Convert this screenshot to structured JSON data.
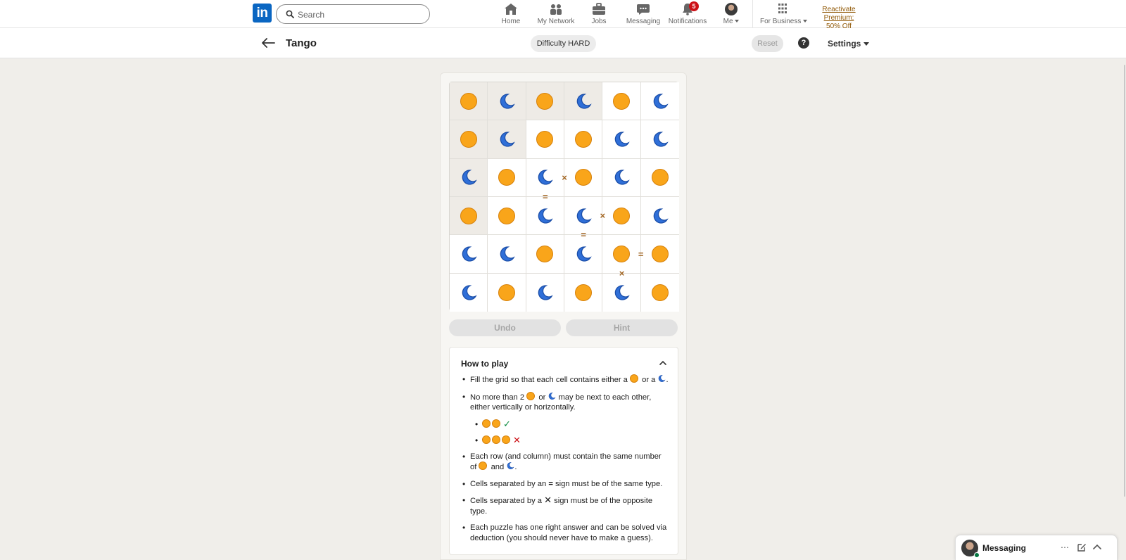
{
  "nav": {
    "logo": "in",
    "search_placeholder": "Search",
    "items": [
      {
        "label": "Home",
        "icon": "home-icon"
      },
      {
        "label": "My Network",
        "icon": "network-icon"
      },
      {
        "label": "Jobs",
        "icon": "briefcase-icon"
      },
      {
        "label": "Messaging",
        "icon": "chat-icon"
      },
      {
        "label": "Notifications",
        "icon": "bell-icon",
        "badge": "5"
      },
      {
        "label": "Me",
        "icon": "avatar"
      },
      {
        "label": "For Business",
        "icon": "grid-icon"
      }
    ],
    "premium_line1": "Reactivate Premium:",
    "premium_line2": "50% Off"
  },
  "header": {
    "title": "Tango",
    "difficulty": "Difficulty HARD",
    "reset": "Reset",
    "help": "?",
    "settings": "Settings"
  },
  "game": {
    "grid": [
      [
        "sun",
        "moon",
        "sun",
        "moon",
        "sun",
        "moon"
      ],
      [
        "sun",
        "moon",
        "sun",
        "sun",
        "moon",
        "moon"
      ],
      [
        "moon",
        "sun",
        "moon",
        "sun",
        "moon",
        "sun"
      ],
      [
        "sun",
        "sun",
        "moon",
        "moon",
        "sun",
        "moon"
      ],
      [
        "moon",
        "moon",
        "sun",
        "moon",
        "sun",
        "sun"
      ],
      [
        "moon",
        "sun",
        "moon",
        "sun",
        "moon",
        "sun"
      ]
    ],
    "locked": [
      [
        true,
        true,
        true,
        true,
        false,
        false
      ],
      [
        true,
        true,
        false,
        false,
        false,
        false
      ],
      [
        true,
        false,
        false,
        false,
        false,
        false
      ],
      [
        true,
        false,
        false,
        false,
        false,
        false
      ],
      [
        false,
        false,
        false,
        false,
        false,
        false
      ],
      [
        false,
        false,
        false,
        false,
        false,
        false
      ]
    ],
    "constraints": [
      {
        "type": "×",
        "between": [
          [
            2,
            2
          ],
          [
            2,
            3
          ]
        ]
      },
      {
        "type": "=",
        "between": [
          [
            2,
            2
          ],
          [
            3,
            2
          ]
        ]
      },
      {
        "type": "×",
        "between": [
          [
            3,
            3
          ],
          [
            3,
            4
          ]
        ]
      },
      {
        "type": "=",
        "between": [
          [
            3,
            3
          ],
          [
            4,
            3
          ]
        ]
      },
      {
        "type": "=",
        "between": [
          [
            4,
            4
          ],
          [
            4,
            5
          ]
        ]
      },
      {
        "type": "×",
        "between": [
          [
            4,
            4
          ],
          [
            5,
            4
          ]
        ]
      }
    ],
    "undo": "Undo",
    "hint": "Hint"
  },
  "howto": {
    "title": "How to play",
    "r1a": "Fill the grid so that each cell contains either a",
    "r1b": "or a",
    "r1c": ".",
    "r2a": "No more than 2",
    "r2b": "or",
    "r2c": "may be next to each other, either vertically or horizontally.",
    "check": "✓",
    "cross": "✕",
    "r3a": "Each row (and column) must contain the same number of",
    "r3b": "and",
    "r3c": ".",
    "r4a": "Cells separated by an",
    "r4eq": "=",
    "r4b": "sign must be of the same type.",
    "r5a": "Cells separated by a",
    "r5x": "✕",
    "r5b": "sign must be of the opposite type.",
    "r6": "Each puzzle has one right answer and can be solved via deduction (you should never have to make a guess)."
  },
  "messaging": {
    "label": "Messaging"
  },
  "colors": {
    "sun": "#f9a51a",
    "moon": "#2f6fd8",
    "constraint": "#a16420",
    "brand": "#0a66c2"
  }
}
